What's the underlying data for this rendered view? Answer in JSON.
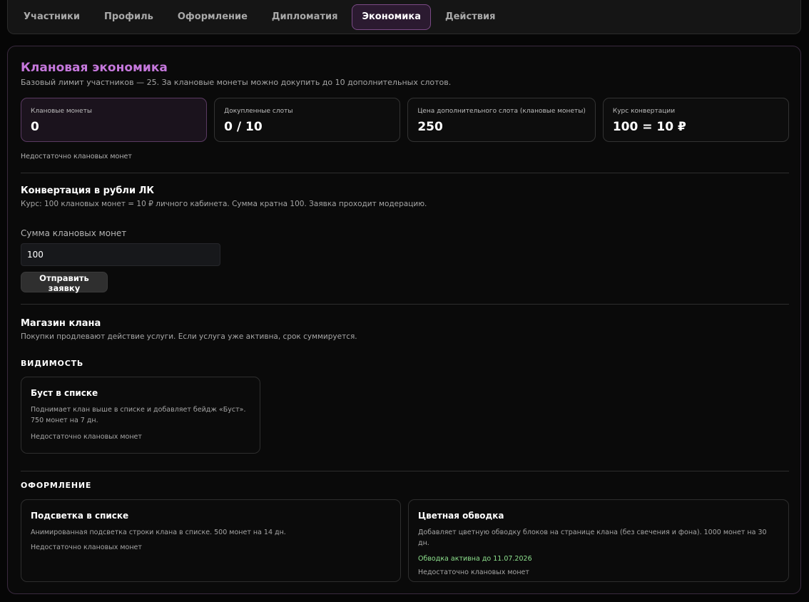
{
  "tabs": [
    {
      "label": "Участники"
    },
    {
      "label": "Профиль"
    },
    {
      "label": "Оформление"
    },
    {
      "label": "Дипломатия"
    },
    {
      "label": "Экономика",
      "active": true
    },
    {
      "label": "Действия"
    }
  ],
  "economy": {
    "title": "Клановая экономика",
    "subtitle": "Базовый лимит участников — 25. За клановые монеты можно докупить до 10 дополнительных слотов.",
    "stats": [
      {
        "label": "Клановые монеты",
        "value": "0"
      },
      {
        "label": "Докупленные слоты",
        "value": "0 / 10"
      },
      {
        "label": "Цена дополнительного слота (клановые монеты)",
        "value": "250"
      },
      {
        "label": "Курс конвертации",
        "value": "100 = 10 ₽"
      }
    ],
    "warning": "Недостаточно клановых монет"
  },
  "conversion": {
    "title": "Конвертация в рубли ЛК",
    "description": "Курс: 100 клановых монет = 10 ₽ личного кабинета. Сумма кратна 100. Заявка проходит модерацию.",
    "field_label": "Сумма клановых монет",
    "field_value": "100",
    "submit_label": "Отправить заявку"
  },
  "shop": {
    "title": "Магазин клана",
    "description": "Покупки продлевают действие услуги. Если услуга уже активна, срок суммируется.",
    "categories": [
      {
        "name": "ВИДИМОСТЬ",
        "items": [
          {
            "title": "Буст в списке",
            "description": "Поднимает клан выше в списке и добавляет бейдж «Буст». 750 монет на 7 дн.",
            "warning": "Недостаточно клановых монет"
          }
        ]
      },
      {
        "name": "ОФОРМЛЕНИЕ",
        "items": [
          {
            "title": "Подсветка в списке",
            "description": "Анимированная подсветка строки клана в списке. 500 монет на 14 дн.",
            "warning": "Недостаточно клановых монет"
          },
          {
            "title": "Цветная обводка",
            "description": "Добавляет цветную обводку блоков на странице клана (без свечения и фона). 1000 монет на 30 дн.",
            "status": "Обводка активна до 11.07.2026",
            "warning": "Недостаточно клановых монет"
          }
        ]
      }
    ]
  }
}
